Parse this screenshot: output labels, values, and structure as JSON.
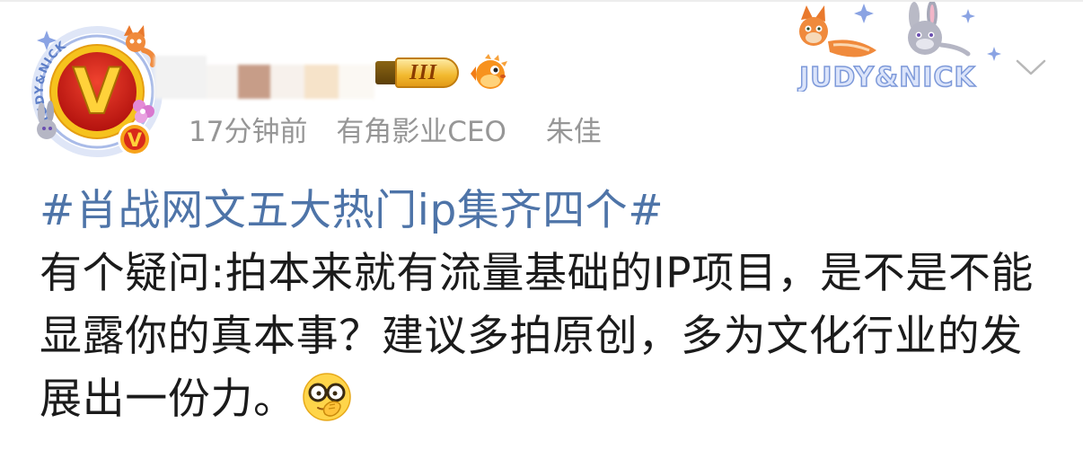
{
  "colors": {
    "link": "#4e74a8",
    "text": "#1b1b1b",
    "meta": "#969696",
    "badge_gold": "#f2b92f"
  },
  "avatar": {
    "letter": "V",
    "badge_letter": "V",
    "frame_text": "JUDY&NICK"
  },
  "author": {
    "level_badge": "III",
    "fan_badge_icon": "pufferfish-icon"
  },
  "meta": {
    "time": "17分钟前",
    "verified_title": "有角影业CEO",
    "verified_name": "朱佳"
  },
  "decoration_card": {
    "text": "JUDY&NICK"
  },
  "menu": {
    "icon": "chevron-down-icon"
  },
  "post": {
    "hashtag": "#肖战网文五大热门ip集齐四个#",
    "body_lines": [
      "有个疑问:拍本来就有流量基础的IP项目，是不是不能",
      "显露你的真本事？建议多拍原创，多为文化行业的发",
      "展出一份力。"
    ],
    "emoji_icon": "glasses-face-emoji"
  }
}
